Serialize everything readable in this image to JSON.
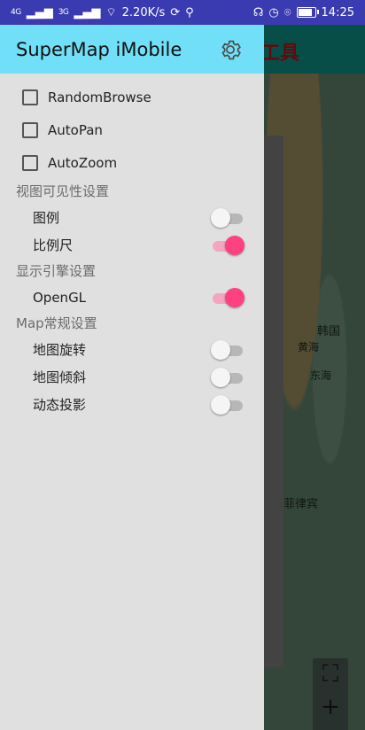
{
  "status_bar": {
    "signal1": "4G",
    "signal2": "3G",
    "speed": "2.20K/s",
    "time": "14:25"
  },
  "background": {
    "toolbar_title": "工具",
    "map_labels": [
      "韩国",
      "黄海",
      "东海",
      "菲律宾"
    ],
    "zoom_in": "+",
    "zoom_out": "−"
  },
  "drawer": {
    "title": "SuperMap iMobile",
    "checkboxes": [
      {
        "label": "RandomBrowse",
        "checked": false
      },
      {
        "label": "AutoPan",
        "checked": false
      },
      {
        "label": "AutoZoom",
        "checked": false
      }
    ],
    "sections": [
      {
        "title": "视图可见性设置",
        "items": [
          {
            "label": "图例",
            "on": false
          },
          {
            "label": "比例尺",
            "on": true
          }
        ]
      },
      {
        "title": "显示引擎设置",
        "items": [
          {
            "label": "OpenGL",
            "on": true
          }
        ]
      },
      {
        "title": "Map常规设置",
        "items": [
          {
            "label": "地图旋转",
            "on": false
          },
          {
            "label": "地图倾斜",
            "on": false
          },
          {
            "label": "动态投影",
            "on": false
          }
        ]
      }
    ]
  },
  "colors": {
    "status_bar": "#3a3bb0",
    "drawer_header": "#71dff7",
    "drawer_bg": "#e0e0e0",
    "switch_on": "#ff4081"
  }
}
